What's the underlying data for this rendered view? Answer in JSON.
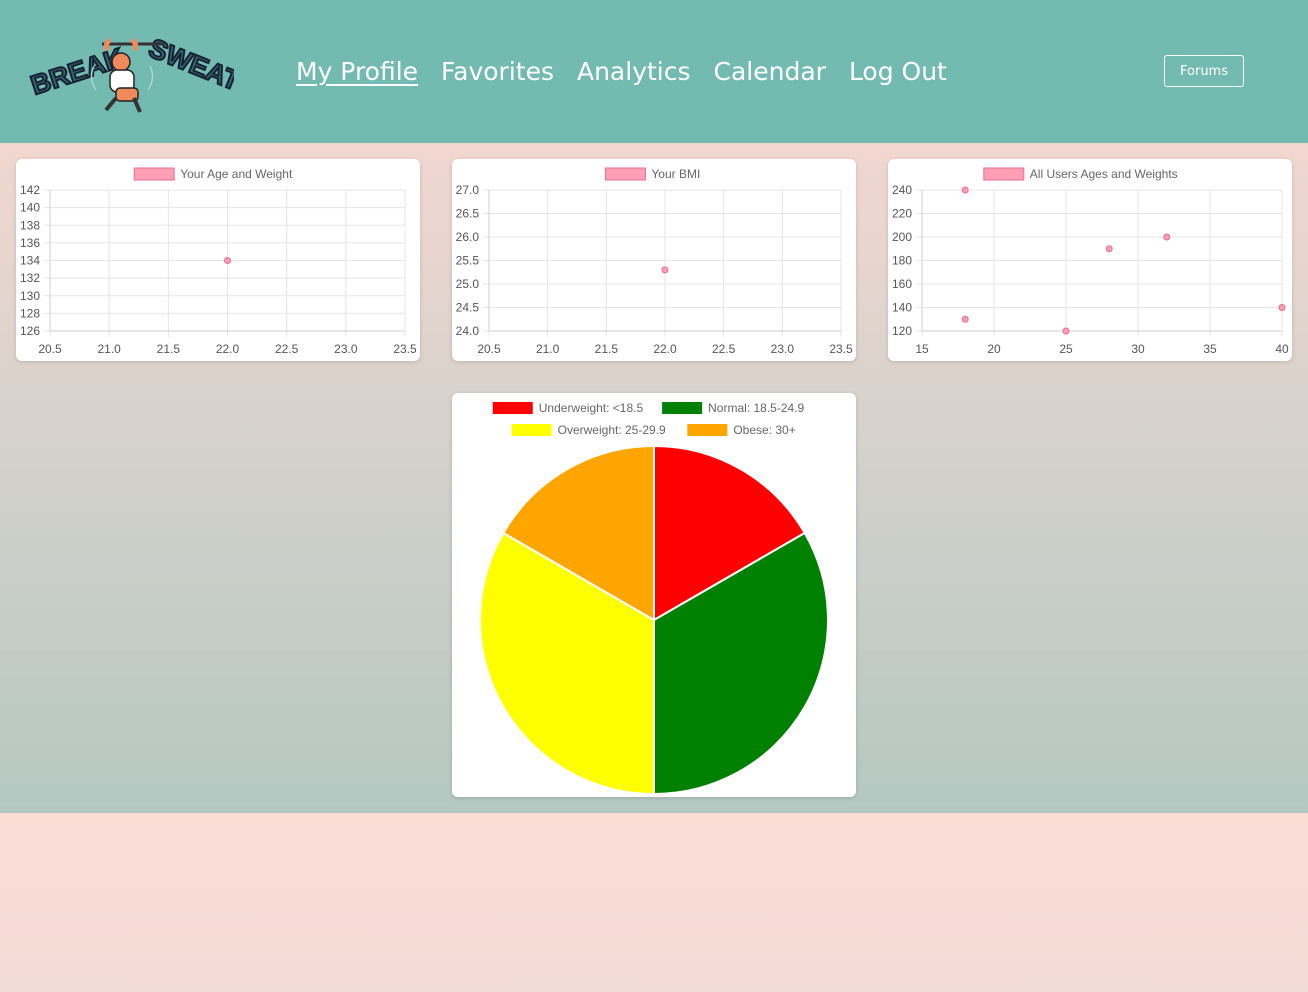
{
  "nav": {
    "links": [
      "My Profile",
      "Favorites",
      "Analytics",
      "Calendar",
      "Log Out"
    ],
    "forums": "Forums"
  },
  "chart_data": [
    {
      "type": "scatter",
      "legend": "Your Age and Weight",
      "x_ticks": [
        20.5,
        21.0,
        21.5,
        22.0,
        22.5,
        23.0,
        23.5
      ],
      "y_ticks": [
        126,
        128,
        130,
        132,
        134,
        136,
        138,
        140,
        142
      ],
      "xlim": [
        20.5,
        23.5
      ],
      "ylim": [
        126,
        142
      ],
      "points": [
        {
          "x": 22,
          "y": 134
        }
      ],
      "grid": true,
      "legend_position": "top"
    },
    {
      "type": "scatter",
      "legend": "Your BMI",
      "x_ticks": [
        20.5,
        21.0,
        21.5,
        22.0,
        22.5,
        23.0,
        23.5
      ],
      "y_ticks": [
        24.0,
        24.5,
        25.0,
        25.5,
        26.0,
        26.5,
        27.0
      ],
      "xlim": [
        20.5,
        23.5
      ],
      "ylim": [
        24.0,
        27.0
      ],
      "points": [
        {
          "x": 22,
          "y": 25.3
        }
      ],
      "grid": true,
      "legend_position": "top"
    },
    {
      "type": "scatter",
      "legend": "All Users Ages and Weights",
      "x_ticks": [
        15,
        20,
        25,
        30,
        35,
        40
      ],
      "y_ticks": [
        120,
        140,
        160,
        180,
        200,
        220,
        240
      ],
      "xlim": [
        15,
        40
      ],
      "ylim": [
        120,
        240
      ],
      "points": [
        {
          "x": 18,
          "y": 240
        },
        {
          "x": 18,
          "y": 130
        },
        {
          "x": 25,
          "y": 120
        },
        {
          "x": 28,
          "y": 190
        },
        {
          "x": 32,
          "y": 200
        },
        {
          "x": 40,
          "y": 140
        }
      ],
      "grid": true,
      "legend_position": "top"
    },
    {
      "type": "pie",
      "legend_position": "top",
      "slices": [
        {
          "label": "Underweight: <18.5",
          "value": 1,
          "color": "#ff0000"
        },
        {
          "label": "Normal: 18.5-24.9",
          "value": 2,
          "color": "#008000"
        },
        {
          "label": "Overweight: 25-29.9",
          "value": 2,
          "color": "#ffff00"
        },
        {
          "label": "Obese: 30+",
          "value": 1,
          "color": "#ffa500"
        }
      ]
    }
  ],
  "colors": {
    "navbar": "#73bab1",
    "point_fill": "#ff9fb5",
    "point_stroke": "#e86d8c",
    "grid": "#e5e5e5",
    "tick_text": "#555555"
  }
}
